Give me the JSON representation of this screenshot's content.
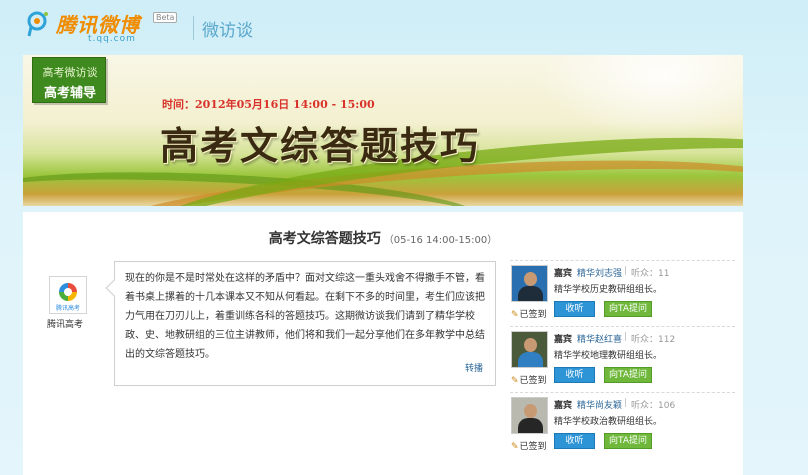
{
  "header": {
    "logo_text": "腾讯微博",
    "logo_beta": "Beta",
    "logo_domain": "t.qq.com",
    "section_title": "微访谈"
  },
  "banner": {
    "badge_top": "高考微访谈",
    "badge_bottom": "高考辅导",
    "time": "时间：2012年05月16日 14:00 - 15:00",
    "title": "高考文综答题技巧"
  },
  "content": {
    "title": "高考文综答题技巧",
    "subtitle": "（05-16 14:00-15:00）",
    "org_logo_text": "腾讯高考",
    "org_name": "腾讯高考",
    "intro_text": "现在的你是不是时常处在这样的矛盾中？面对文综这一重头戏舍不得撒手不管，看着书桌上摞着的十几本课本又不知从何看起。在剩下不多的时间里，考生们应该把力气用在刀刃儿上，着重训练各科的答题技巧。这期微访谈我们请到了精华学校政、史、地教研组的三位主讲教师，他们将和我们一起分享他们在多年教学中总结出的文综答题技巧。",
    "repost_label": "转播"
  },
  "guests": [
    {
      "role": "嘉宾",
      "name": "精华刘志强",
      "listeners": "听众：11",
      "desc": "精华学校历史教研组组长。",
      "signed": "已签到",
      "listen_label": "收听",
      "ask_label": "向TA提问",
      "photo_bg": "#2a6fb0",
      "photo_body": "#1f2c3a"
    },
    {
      "role": "嘉宾",
      "name": "精华赵红喜",
      "listeners": "听众：112",
      "desc": "精华学校地理教研组组长。",
      "signed": "已签到",
      "listen_label": "收听",
      "ask_label": "向TA提问",
      "photo_bg": "#4a5a3a",
      "photo_body": "#2f7fc2"
    },
    {
      "role": "嘉宾",
      "name": "精华尚友颖",
      "listeners": "听众：106",
      "desc": "精华学校政治教研组组长。",
      "signed": "已签到",
      "listen_label": "收听",
      "ask_label": "向TA提问",
      "photo_bg": "#b9b9b0",
      "photo_body": "#262626"
    }
  ],
  "colors": {
    "listen_button": "#2d94d6",
    "ask_button": "#6fb83c",
    "badge": "#3f8a1e",
    "time_text": "#d8322a"
  }
}
